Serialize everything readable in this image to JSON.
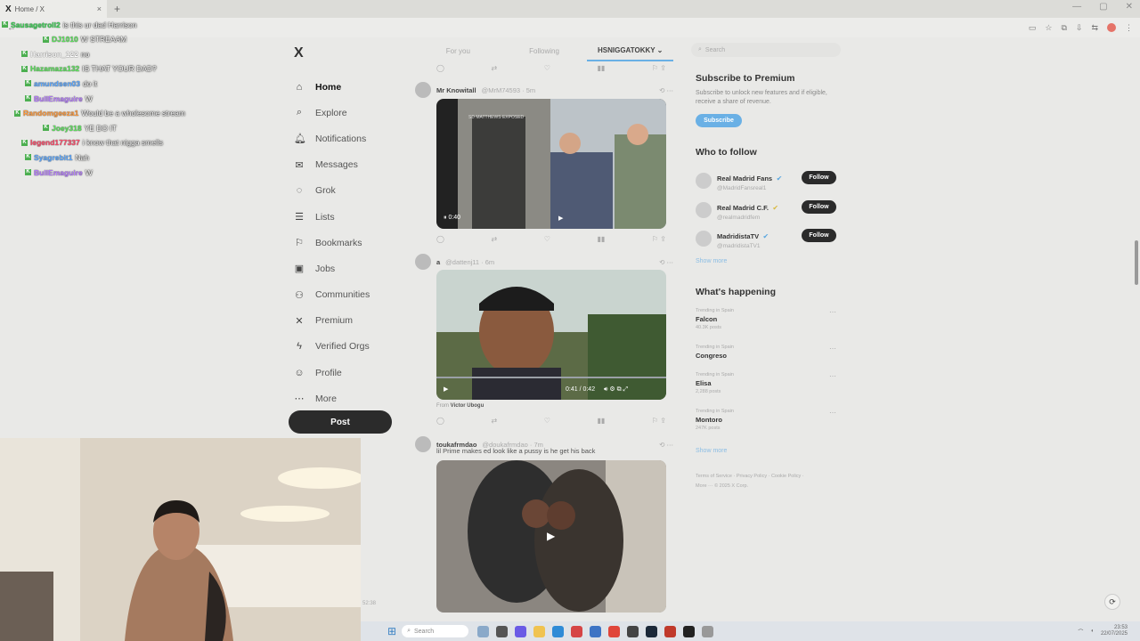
{
  "browser": {
    "tab_title": "Home / X",
    "new_tab": "+",
    "close": "×",
    "minimize": "—",
    "maximize": "▢",
    "window_close": "✕"
  },
  "chat": {
    "messages": [
      {
        "user": "Sausagetroll2",
        "text": "is this ur dad Harrison",
        "color": "#39d353",
        "indent": 2
      },
      {
        "user": "DJ1010",
        "text": "W STREAAM",
        "color": "#5be35b",
        "indent": 48
      },
      {
        "user": "Harrison_122",
        "text": "no",
        "color": "#ffffff",
        "indent": 24
      },
      {
        "user": "Hazamaza132",
        "text": "IS THAT YOUR DAD?",
        "color": "#5be35b",
        "indent": 24
      },
      {
        "user": "amundsen03",
        "text": "do it",
        "color": "#5aa7ff",
        "indent": 28
      },
      {
        "user": "BullEmaguire",
        "text": "W",
        "color": "#b57cff",
        "indent": 28
      },
      {
        "user": "Randomgeeza1",
        "text": "Would be a wholesome stream",
        "color": "#ff9a3c",
        "indent": 16
      },
      {
        "user": "Joey318",
        "text": "YE DO IT",
        "color": "#5be35b",
        "indent": 48
      },
      {
        "user": "legend177337",
        "text": "i know that nigga smells",
        "color": "#ff4a6a",
        "indent": 24
      },
      {
        "user": "Syagrebit1",
        "text": "Nah",
        "color": "#5aa7ff",
        "indent": 28
      },
      {
        "user": "BullEmaguire",
        "text": "W",
        "color": "#b57cff",
        "indent": 28
      }
    ]
  },
  "xnav": {
    "logo": "X",
    "items": [
      {
        "label": "Home",
        "icon": "⌂",
        "name": "home"
      },
      {
        "label": "Explore",
        "icon": "⌕",
        "name": "explore"
      },
      {
        "label": "Notifications",
        "icon": "🔔︎",
        "name": "notifications"
      },
      {
        "label": "Messages",
        "icon": "✉",
        "name": "messages"
      },
      {
        "label": "Grok",
        "icon": "◌",
        "name": "grok"
      },
      {
        "label": "Lists",
        "icon": "☰",
        "name": "lists"
      },
      {
        "label": "Bookmarks",
        "icon": "⚐",
        "name": "bookmarks"
      },
      {
        "label": "Jobs",
        "icon": "▣",
        "name": "jobs"
      },
      {
        "label": "Communities",
        "icon": "⚇",
        "name": "communities"
      },
      {
        "label": "Premium",
        "icon": "✕",
        "name": "premium"
      },
      {
        "label": "Verified Orgs",
        "icon": "ϟ",
        "name": "verified-orgs"
      },
      {
        "label": "Profile",
        "icon": "☺",
        "name": "profile"
      },
      {
        "label": "More",
        "icon": "⋯",
        "name": "more"
      }
    ],
    "post_label": "Post"
  },
  "feed": {
    "tabs": [
      "For you",
      "Following",
      "HSNIGGATOKKY ⌄"
    ],
    "tweets": [
      {
        "name": "Mr Knowitall",
        "handle": "@MrM74593 · 5m",
        "video_time": "0:40",
        "overlay_text": "SD MATTHEWS EXPOSED"
      },
      {
        "name": "a",
        "handle": "@dattenj11 · 6m",
        "video_time": "0:41 / 0:42",
        "from": "From",
        "from_name": "Victor Ubogu"
      },
      {
        "name": "toukafrmdao",
        "handle": "@doukafrmdao · 7m",
        "text": "lil Prime makes ed look like a pussy is he get his back"
      }
    ]
  },
  "sidebar": {
    "search_placeholder": "Search",
    "premium_title": "Subscribe to Premium",
    "premium_sub": "Subscribe to unlock new features and if eligible, receive a share of revenue.",
    "subscribe": "Subscribe",
    "who_to_follow": "Who to follow",
    "follows": [
      {
        "name": "Real Madrid Fans",
        "handle": "@MadridFansreal1"
      },
      {
        "name": "Real Madrid C.F.",
        "handle": "@realmadridfem"
      },
      {
        "name": "MadridistaTV",
        "handle": "@madridistaTV1"
      }
    ],
    "follow_label": "Follow",
    "show_more": "Show more",
    "whats_happening": "What's happening",
    "trends": [
      {
        "context": "Trending in Spain",
        "title": "Falcon",
        "count": "40.3K posts"
      },
      {
        "context": "Trending in Spain",
        "title": "Congreso",
        "count": ""
      },
      {
        "context": "Trending in Spain",
        "title": "Elisa",
        "count": "2,288 posts"
      },
      {
        "context": "Trending in Spain",
        "title": "Montoro",
        "count": "247K posts"
      }
    ],
    "footer_line1": "Terms of Service · Privacy Policy · Cookie Policy ·",
    "footer_line2": "More ··· © 2025 X Corp."
  },
  "taskbar": {
    "search": "Search",
    "time": "23:53",
    "date": "22/07/2025"
  },
  "webcam": {
    "timestamp": "52:38"
  }
}
